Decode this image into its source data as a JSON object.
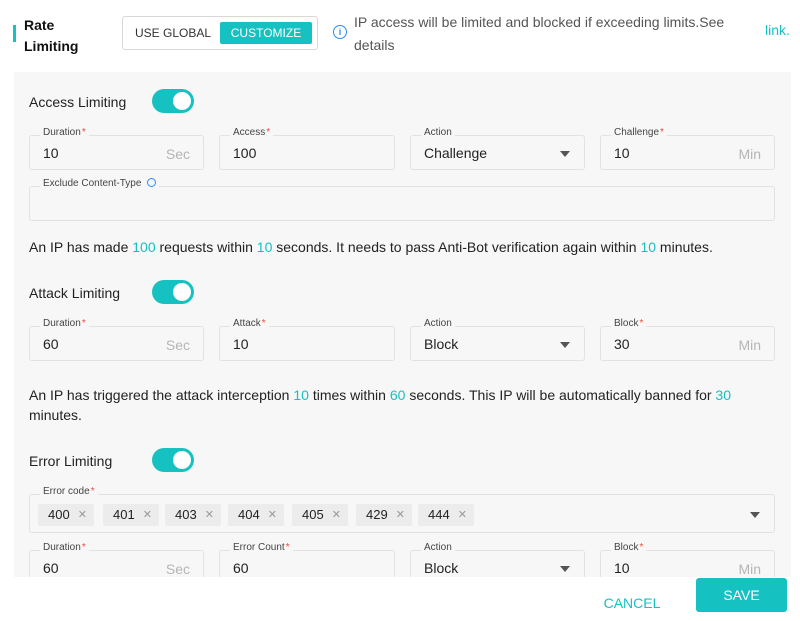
{
  "header": {
    "title": "Rate Limiting",
    "mode_options": [
      "USE GLOBAL",
      "CUSTOMIZE"
    ],
    "selected_mode": "CUSTOMIZE",
    "info_text": "IP access will be limited and blocked if exceeding limits.See details",
    "info_link": "link."
  },
  "access_limiting": {
    "label": "Access Limiting",
    "enabled": true,
    "duration": {
      "label": "Duration",
      "value": "10",
      "unit": "Sec"
    },
    "access": {
      "label": "Access",
      "value": "100"
    },
    "action": {
      "label": "Action",
      "value": "Challenge"
    },
    "challenge": {
      "label": "Challenge",
      "value": "10",
      "unit": "Min"
    },
    "exclude": {
      "label": "Exclude Content-Type",
      "value": ""
    },
    "desc": {
      "p1": "An IP has made ",
      "v1": "100",
      "p2": " requests within ",
      "v2": "10",
      "p3": " seconds. It needs to pass Anti-Bot verification again within ",
      "v3": "10",
      "p4": " minutes."
    }
  },
  "attack_limiting": {
    "label": "Attack Limiting",
    "enabled": true,
    "duration": {
      "label": "Duration",
      "value": "60",
      "unit": "Sec"
    },
    "attack": {
      "label": "Attack",
      "value": "10"
    },
    "action": {
      "label": "Action",
      "value": "Block"
    },
    "block": {
      "label": "Block",
      "value": "30",
      "unit": "Min"
    },
    "desc": {
      "p1": "An IP has triggered the attack interception ",
      "v1": "10",
      "p2": " times within ",
      "v2": "60",
      "p3": " seconds. This IP will be automatically banned for ",
      "v3": "30",
      "p4": " minutes."
    }
  },
  "error_limiting": {
    "label": "Error Limiting",
    "enabled": true,
    "error_code": {
      "label": "Error code",
      "tags": [
        "400",
        "401",
        "403",
        "404",
        "405",
        "429",
        "444"
      ]
    },
    "duration": {
      "label": "Duration",
      "value": "60",
      "unit": "Sec"
    },
    "error_count": {
      "label": "Error Count",
      "value": "60"
    },
    "action": {
      "label": "Action",
      "value": "Block"
    },
    "block": {
      "label": "Block",
      "value": "10",
      "unit": "Min"
    }
  },
  "footer": {
    "cancel": "CANCEL",
    "save": "SAVE"
  },
  "colors": {
    "accent": "#16c1c1",
    "required": "#e74c3c",
    "info": "#2d8cf0"
  }
}
